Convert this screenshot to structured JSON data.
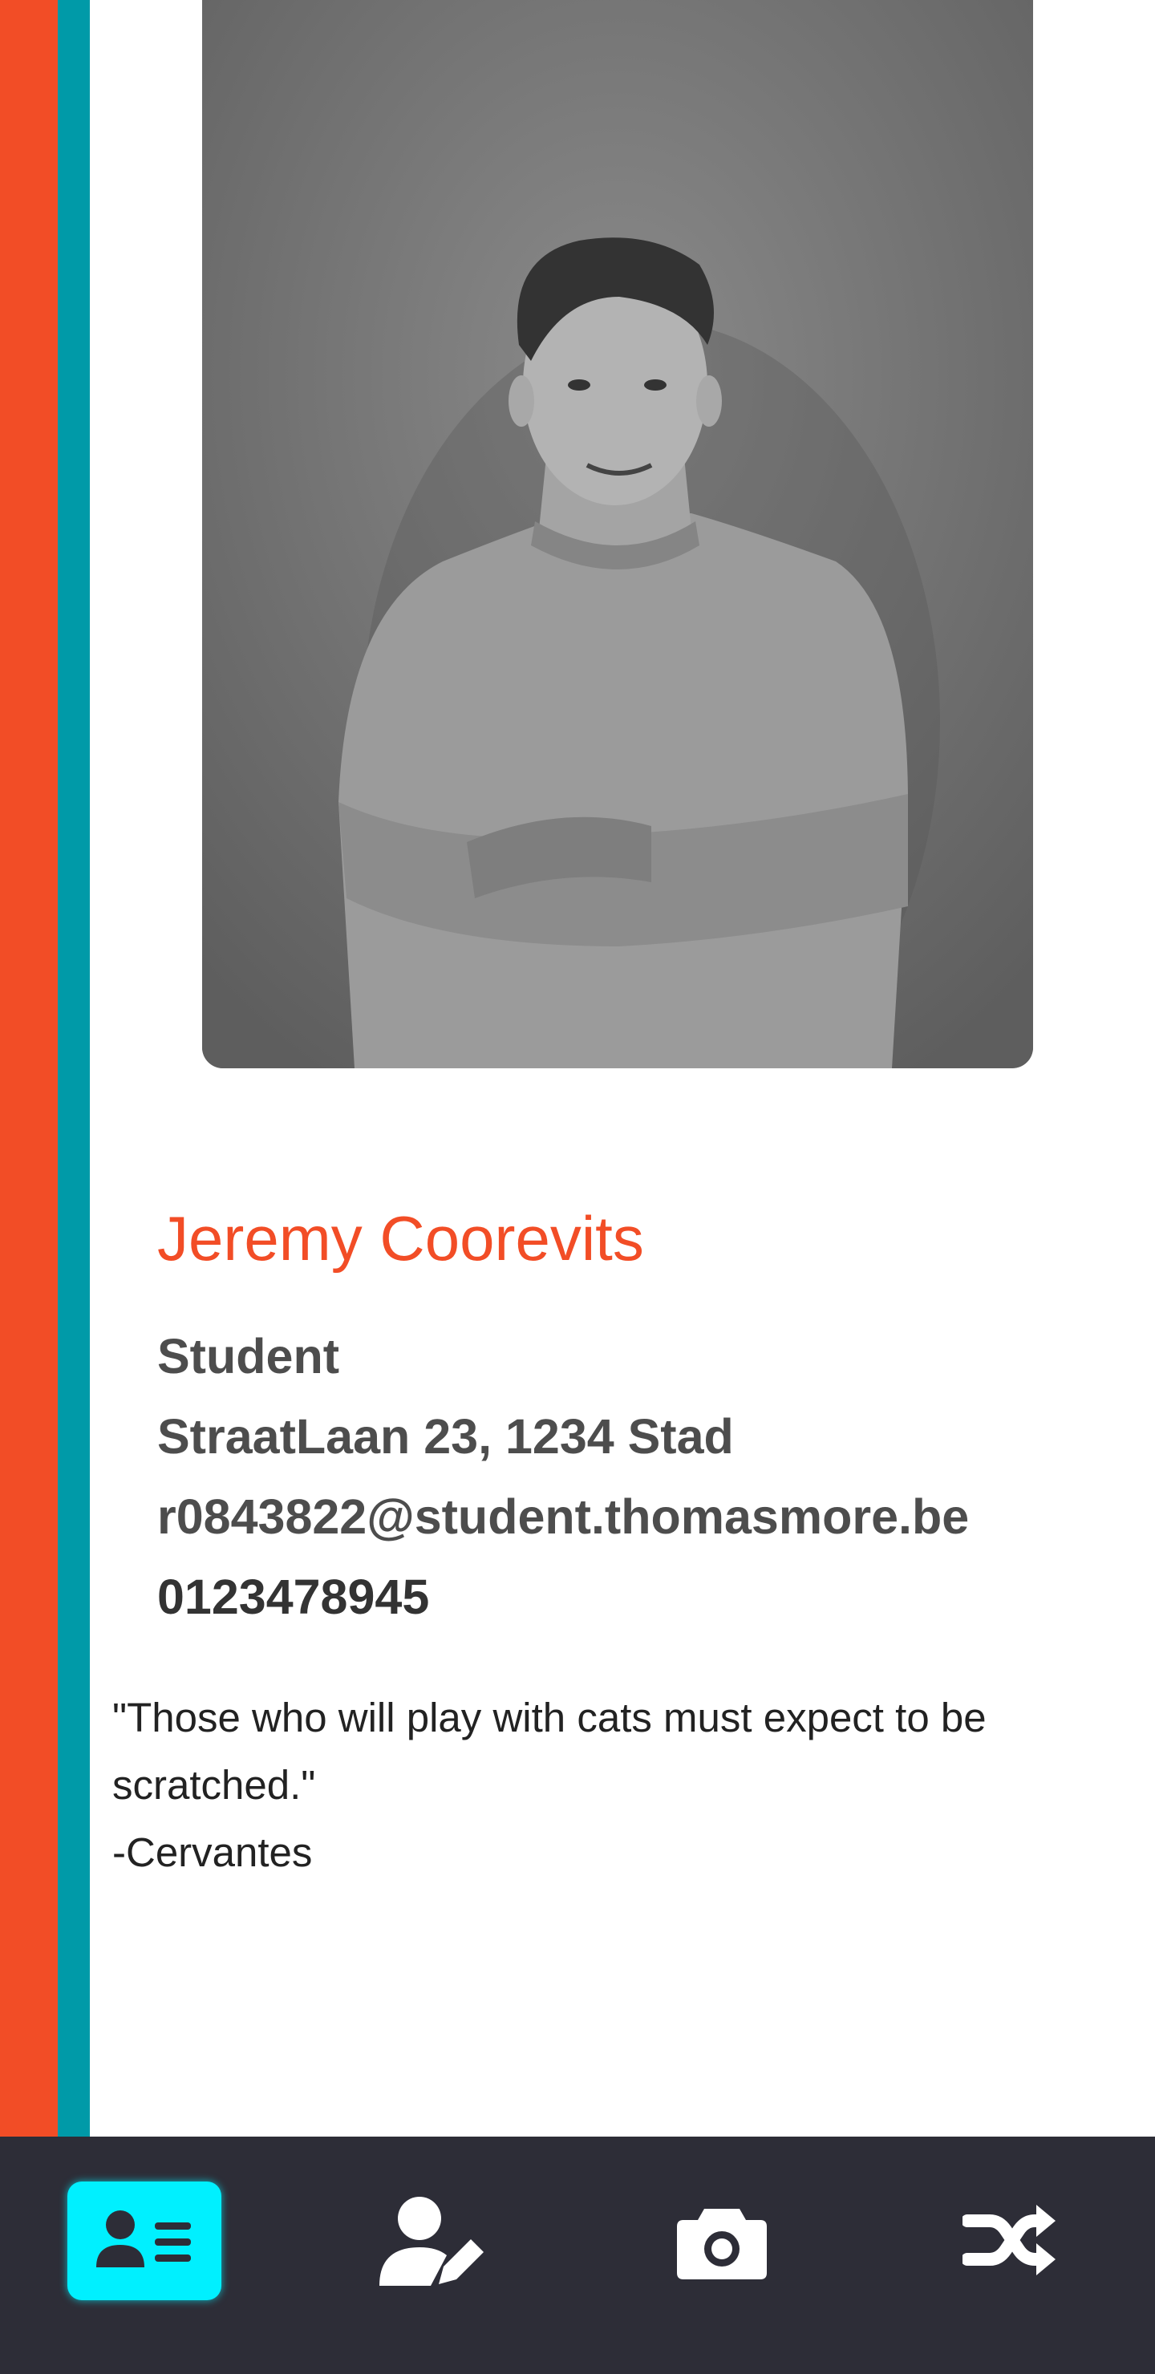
{
  "profile": {
    "name": "Jeremy Coorevits",
    "role": "Student",
    "address": "StraatLaan 23, 1234 Stad",
    "email": "r0843822@student.thomasmore.be",
    "phone": "0123478945"
  },
  "quote": {
    "line1": "\"Those who will play with cats must expect to be",
    "line2": "scratched.\"",
    "author": "-Cervantes"
  },
  "nav": {
    "items": [
      {
        "icon": "id-card-icon",
        "active": true
      },
      {
        "icon": "user-edit-icon",
        "active": false
      },
      {
        "icon": "camera-icon",
        "active": false
      },
      {
        "icon": "shuffle-icon",
        "active": false
      }
    ]
  },
  "colors": {
    "accent": "#f24d26",
    "teal": "#009aa8",
    "nav_background": "#2d2d37",
    "nav_active": "#00f0ff",
    "text": "#4d4d4d"
  }
}
